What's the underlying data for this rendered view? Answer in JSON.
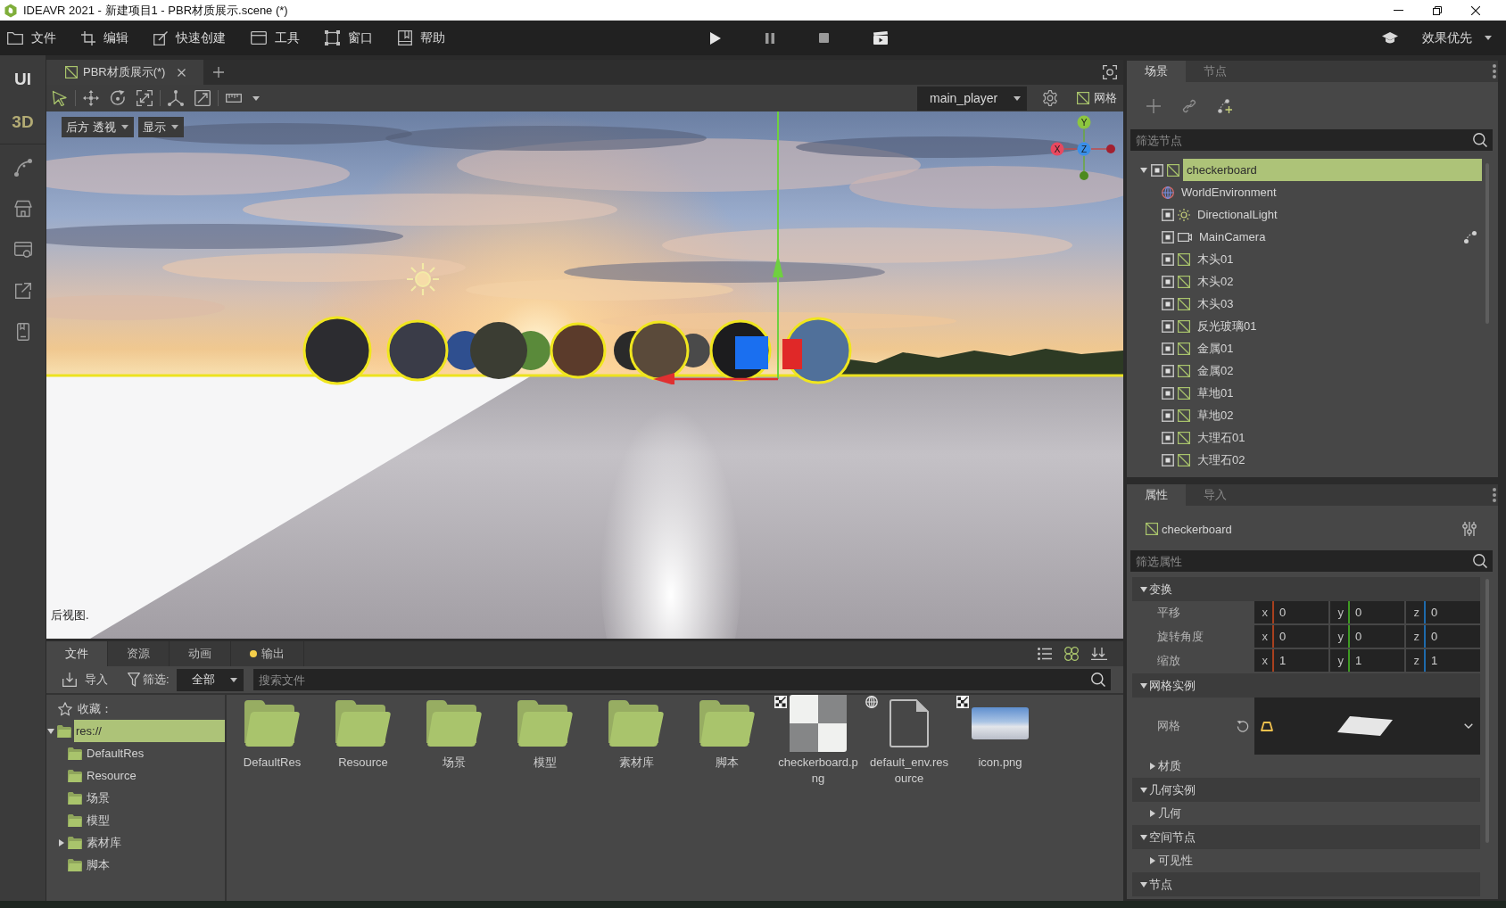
{
  "window": {
    "title": "IDEAVR 2021 - 新建项目1 - PBR材质展示.scene (*)"
  },
  "menu": [
    {
      "label": "文件"
    },
    {
      "label": "编辑"
    },
    {
      "label": "快速创建"
    },
    {
      "label": "工具"
    },
    {
      "label": "窗口"
    },
    {
      "label": "帮助"
    }
  ],
  "quality": {
    "label": "效果优先"
  },
  "side_modes": [
    {
      "label": "UI",
      "selected": false
    },
    {
      "label": "3D",
      "selected": true
    }
  ],
  "editor_tabs": [
    {
      "label": "PBR材质展示(*)",
      "selected": true
    }
  ],
  "viewport_toolbar": {
    "tools": [
      {
        "kind": "select",
        "selected": true
      },
      {
        "kind": "move",
        "selected": false
      },
      {
        "kind": "rotate",
        "selected": false
      },
      {
        "kind": "scale",
        "selected": false
      },
      {
        "kind": "pivot",
        "selected": false
      },
      {
        "kind": "snap",
        "selected": false
      },
      {
        "kind": "ruler",
        "selected": false
      }
    ],
    "camera": "main_player",
    "grid_toggle": "网格"
  },
  "viewport": {
    "view_menu": "后方 透视",
    "display_menu": "显示",
    "axis_gizmo": [
      {
        "label": "Y",
        "color": "#8dc63f"
      },
      {
        "label": "X",
        "color": "#e8485f"
      },
      {
        "label": "Z",
        "color": "#3b8fe8"
      }
    ],
    "view_label": "后视图."
  },
  "scene_panel": {
    "tabs": [
      {
        "label": "场景",
        "selected": true
      },
      {
        "label": "节点",
        "selected": false
      }
    ],
    "filter": {
      "placeholder": "筛选节点"
    },
    "tree": [
      {
        "name": "checkerboard",
        "kind": "mesh",
        "visible": true,
        "selected": true,
        "expanded": true,
        "script": false,
        "children": [
          {
            "name": "WorldEnvironment",
            "kind": "environment",
            "selected": false,
            "script": false
          },
          {
            "name": "DirectionalLight",
            "kind": "light",
            "visible": true,
            "selected": false,
            "script": false
          },
          {
            "name": "MainCamera",
            "kind": "camera",
            "visible": true,
            "selected": false,
            "script": true
          },
          {
            "name": "木头01",
            "kind": "mesh",
            "visible": true,
            "selected": false,
            "script": false
          },
          {
            "name": "木头02",
            "kind": "mesh",
            "visible": true,
            "selected": false,
            "script": false
          },
          {
            "name": "木头03",
            "kind": "mesh",
            "visible": true,
            "selected": false,
            "script": false
          },
          {
            "name": "反光玻璃01",
            "kind": "mesh",
            "visible": true,
            "selected": false,
            "script": false
          },
          {
            "name": "金属01",
            "kind": "mesh",
            "visible": true,
            "selected": false,
            "script": false
          },
          {
            "name": "金属02",
            "kind": "mesh",
            "visible": true,
            "selected": false,
            "script": false
          },
          {
            "name": "草地01",
            "kind": "mesh",
            "visible": true,
            "selected": false,
            "script": false
          },
          {
            "name": "草地02",
            "kind": "mesh",
            "visible": true,
            "selected": false,
            "script": false
          },
          {
            "name": "大理石01",
            "kind": "mesh",
            "visible": true,
            "selected": false,
            "script": false
          },
          {
            "name": "大理石02",
            "kind": "mesh",
            "visible": true,
            "selected": false,
            "script": false
          }
        ]
      }
    ]
  },
  "inspector": {
    "tabs": [
      {
        "label": "属性",
        "selected": true
      },
      {
        "label": "导入",
        "selected": false
      }
    ],
    "node": {
      "name": "checkerboard",
      "kind": "mesh"
    },
    "filter": {
      "placeholder": "筛选属性"
    },
    "sections": [
      {
        "title": "变换",
        "expanded": true,
        "rows": [
          {
            "kind": "vector",
            "label": "平移",
            "fields": [
              {
                "axis": "x",
                "value": "0",
                "color": "#a8401e"
              },
              {
                "axis": "y",
                "value": "0",
                "color": "#3e9a22"
              },
              {
                "axis": "z",
                "value": "0",
                "color": "#1e6aac"
              }
            ]
          },
          {
            "kind": "vector",
            "label": "旋转角度",
            "fields": [
              {
                "axis": "x",
                "value": "0",
                "color": "#a8401e"
              },
              {
                "axis": "y",
                "value": "0",
                "color": "#3e9a22"
              },
              {
                "axis": "z",
                "value": "0",
                "color": "#1e6aac"
              }
            ]
          },
          {
            "kind": "vector",
            "label": "缩放",
            "fields": [
              {
                "axis": "x",
                "value": "1",
                "color": "#a8401e"
              },
              {
                "axis": "y",
                "value": "1",
                "color": "#3e9a22"
              },
              {
                "axis": "z",
                "value": "1",
                "color": "#1e6aac"
              }
            ]
          }
        ]
      },
      {
        "title": "网格实例",
        "expanded": true,
        "rows": [
          {
            "kind": "resource",
            "label": "网格"
          },
          {
            "kind": "group",
            "label": "材质",
            "expanded": false
          }
        ]
      },
      {
        "title": "几何实例",
        "expanded": true,
        "rows": [
          {
            "kind": "group",
            "label": "几何",
            "expanded": false
          }
        ]
      },
      {
        "title": "空间节点",
        "expanded": true,
        "rows": [
          {
            "kind": "group",
            "label": "可见性",
            "expanded": false
          }
        ]
      },
      {
        "title": "节点",
        "expanded": true
      }
    ]
  },
  "file_panel": {
    "tabs": [
      {
        "label": "文件",
        "selected": true,
        "notice": false
      },
      {
        "label": "资源",
        "selected": false,
        "notice": false
      },
      {
        "label": "动画",
        "selected": false,
        "notice": false
      },
      {
        "label": "输出",
        "selected": false,
        "notice": true
      }
    ],
    "view_modes": [
      {
        "kind": "list",
        "selected": false
      },
      {
        "kind": "grid",
        "selected": true
      }
    ],
    "import_label": "导入",
    "filter_label": "筛选:",
    "filter_value": "全部",
    "search": {
      "placeholder": "搜索文件"
    },
    "favorites_label": "收藏：",
    "tree": [
      {
        "name": "res://",
        "selected": true,
        "expanded": true,
        "children": [
          {
            "name": "DefaultRes",
            "selected": false
          },
          {
            "name": "Resource",
            "selected": false
          },
          {
            "name": "场景",
            "selected": false
          },
          {
            "name": "模型",
            "selected": false
          },
          {
            "name": "素材库",
            "selected": false,
            "expanded": false
          },
          {
            "name": "脚本",
            "selected": false
          }
        ]
      }
    ],
    "files": [
      {
        "name": "DefaultRes",
        "kind": "folder"
      },
      {
        "name": "Resource",
        "kind": "folder"
      },
      {
        "name": "场景",
        "kind": "folder"
      },
      {
        "name": "模型",
        "kind": "folder"
      },
      {
        "name": "素材库",
        "kind": "folder"
      },
      {
        "name": "脚本",
        "kind": "folder"
      },
      {
        "name": "checkerboard.png",
        "kind": "texture"
      },
      {
        "name": "default_env.resource",
        "kind": "resource"
      },
      {
        "name": "icon.png",
        "kind": "image"
      }
    ]
  }
}
